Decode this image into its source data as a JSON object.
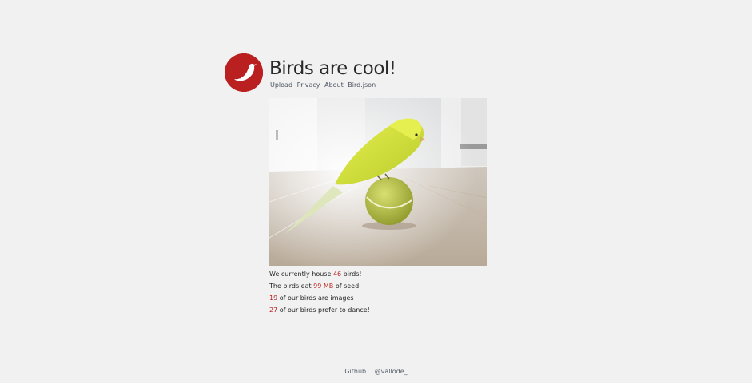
{
  "header": {
    "title": "Birds are cool!",
    "logo_icon": "bird-icon",
    "accent_color": "#b9201f"
  },
  "nav": {
    "items": [
      {
        "label": "Upload"
      },
      {
        "label": "Privacy"
      },
      {
        "label": "About"
      },
      {
        "label": "Bird.json"
      }
    ]
  },
  "stats": {
    "line1": {
      "pre": "We currently house ",
      "num": "46",
      "post": " birds!"
    },
    "line2": {
      "pre": "The birds eat ",
      "num": "99 MB",
      "post": " of seed"
    },
    "line3": {
      "num": "19",
      "post": " of our birds are images"
    },
    "line4": {
      "num": "27",
      "post": " of our birds prefer to dance!"
    }
  },
  "footer": {
    "links": [
      {
        "label": "Github"
      },
      {
        "label": "@vallode_"
      }
    ]
  }
}
